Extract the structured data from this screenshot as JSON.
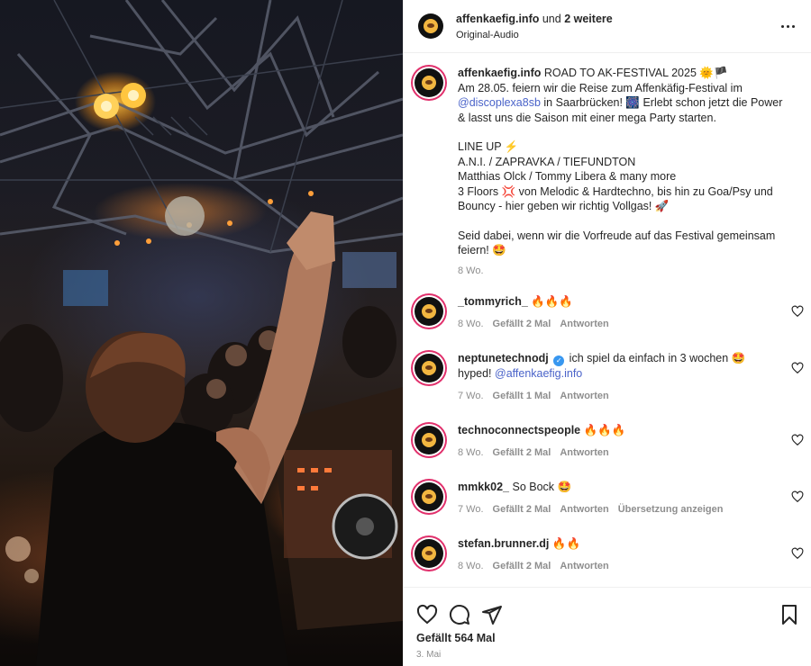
{
  "post": {
    "author": "affenkaefig.info",
    "coauthors_text": "und",
    "coauthors_count": "2 weitere",
    "audio": "Original-Audio"
  },
  "caption": {
    "username": "affenkaefig.info",
    "lines": [
      "ROAD TO AK-FESTIVAL 2025 🌞🏴",
      "Am 28.05. feiern wir die Reise zum Affenkäfig-Festival im",
      "@discoplexa8sb",
      "in Saarbrücken! 🎆 Erlebt schon jetzt die Power & lasst uns die Saison mit einer mega Party starten.",
      "LINE UP ⚡",
      "A.N.I. / ZAPRAVKA / TIEFUNDTON",
      "Matthias Olck / Tommy Libera & many more",
      "3 Floors 💢 von Melodic & Hardtechno, bis hin zu Goa/Psy und Bouncy - hier geben wir richtig Vollgas! 🚀",
      "Seid dabei, wenn wir die Vorfreude auf das Festival gemeinsam feiern! 🤩"
    ],
    "time": "8 Wo."
  },
  "comments": [
    {
      "user": "_tommyrich_",
      "text": "🔥🔥🔥",
      "time": "8 Wo.",
      "likes": "Gefällt 2 Mal",
      "reply": "Antworten"
    },
    {
      "user": "neptunetechnodj",
      "text": "ich spiel da einfach in 3 wochen 🤩 hyped!",
      "mention": "@affenkaefig.info",
      "time": "7 Wo.",
      "likes": "Gefällt 1 Mal",
      "reply": "Antworten"
    },
    {
      "user": "technoconnectspeople",
      "text": "🔥🔥🔥",
      "time": "8 Wo.",
      "likes": "Gefällt 2 Mal",
      "reply": "Antworten"
    },
    {
      "user": "mmkk02_",
      "text": "So Bock 🤩",
      "time": "7 Wo.",
      "likes": "Gefällt 2 Mal",
      "reply": "Antworten",
      "translate": "Übersetzung anzeigen"
    },
    {
      "user": "stefan.brunner.dj",
      "text": "🔥🔥",
      "time": "8 Wo.",
      "likes": "Gefällt 2 Mal",
      "reply": "Antworten"
    }
  ],
  "footer": {
    "likes": "Gefällt 564 Mal",
    "date": "3. Mai"
  },
  "icons": {
    "like": "heart-icon",
    "comment": "comment-icon",
    "share": "send-icon",
    "save": "bookmark-icon",
    "more": "more-icon"
  }
}
